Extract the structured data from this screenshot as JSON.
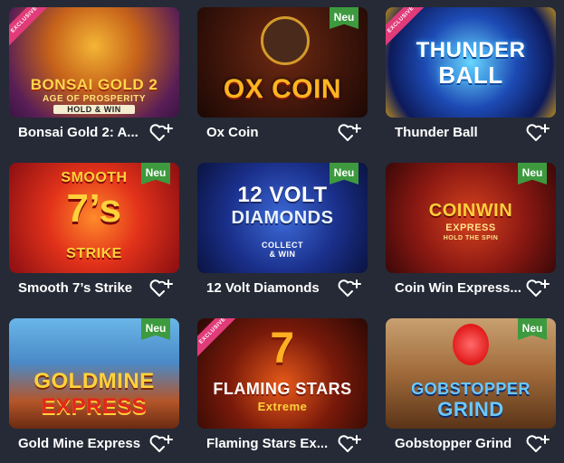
{
  "games": [
    {
      "name": "Bonsai Gold 2: Age of Prosperity",
      "display": "Bonsai Gold 2: A...",
      "art_line1": "BONSAI GOLD 2",
      "art_line2": "AGE OF PROSPERITY",
      "art_line3": "HOLD & WIN",
      "badge": "EXCLUSIVE"
    },
    {
      "name": "Ox Coin",
      "display": "Ox Coin",
      "art_line1": "OX COIN",
      "badge": "Neu"
    },
    {
      "name": "Thunder Ball",
      "display": "Thunder Ball",
      "art_line1": "THUNDER",
      "art_line2": "BALL",
      "badge": "EXCLUSIVE"
    },
    {
      "name": "Smooth 7’s Strike",
      "display": "Smooth 7’s Strike",
      "art_line1": "SMOOTH",
      "art_line2": "7’s",
      "art_line3": "STRIKE",
      "badge": "Neu"
    },
    {
      "name": "12 Volt Diamonds",
      "display": "12 Volt Diamonds",
      "art_line1": "12 VOLT",
      "art_line2": "DIAMONDS",
      "art_line3": "COLLECT & WIN",
      "badge": "Neu"
    },
    {
      "name": "Coin Win Express",
      "display": "Coin Win Express...",
      "art_line1": "COINWIN",
      "art_line2": "EXPRESS",
      "art_line3": "HOLD THE SPIN",
      "badge": "Neu"
    },
    {
      "name": "Gold Mine Express",
      "display": "Gold Mine Express",
      "art_line1": "GOLDMINE",
      "art_line2": "EXPRESS",
      "badge": "Neu"
    },
    {
      "name": "Flaming Stars Extreme",
      "display": "Flaming Stars Ex...",
      "art_line1": "7",
      "art_line2": "FLAMING STARS",
      "art_line3": "Extreme",
      "badge": "EXCLUSIVE"
    },
    {
      "name": "Gobstopper Grind",
      "display": "Gobstopper Grind",
      "art_line1": "GOBSTOPPER",
      "art_line2": "GRIND",
      "badge": "Neu"
    }
  ],
  "colors": {
    "background": "#252a36",
    "badge_new": "#3d9a3f",
    "badge_exclusive": "#e23b7a"
  },
  "icons": {
    "favorite": "heart-plus-icon"
  }
}
